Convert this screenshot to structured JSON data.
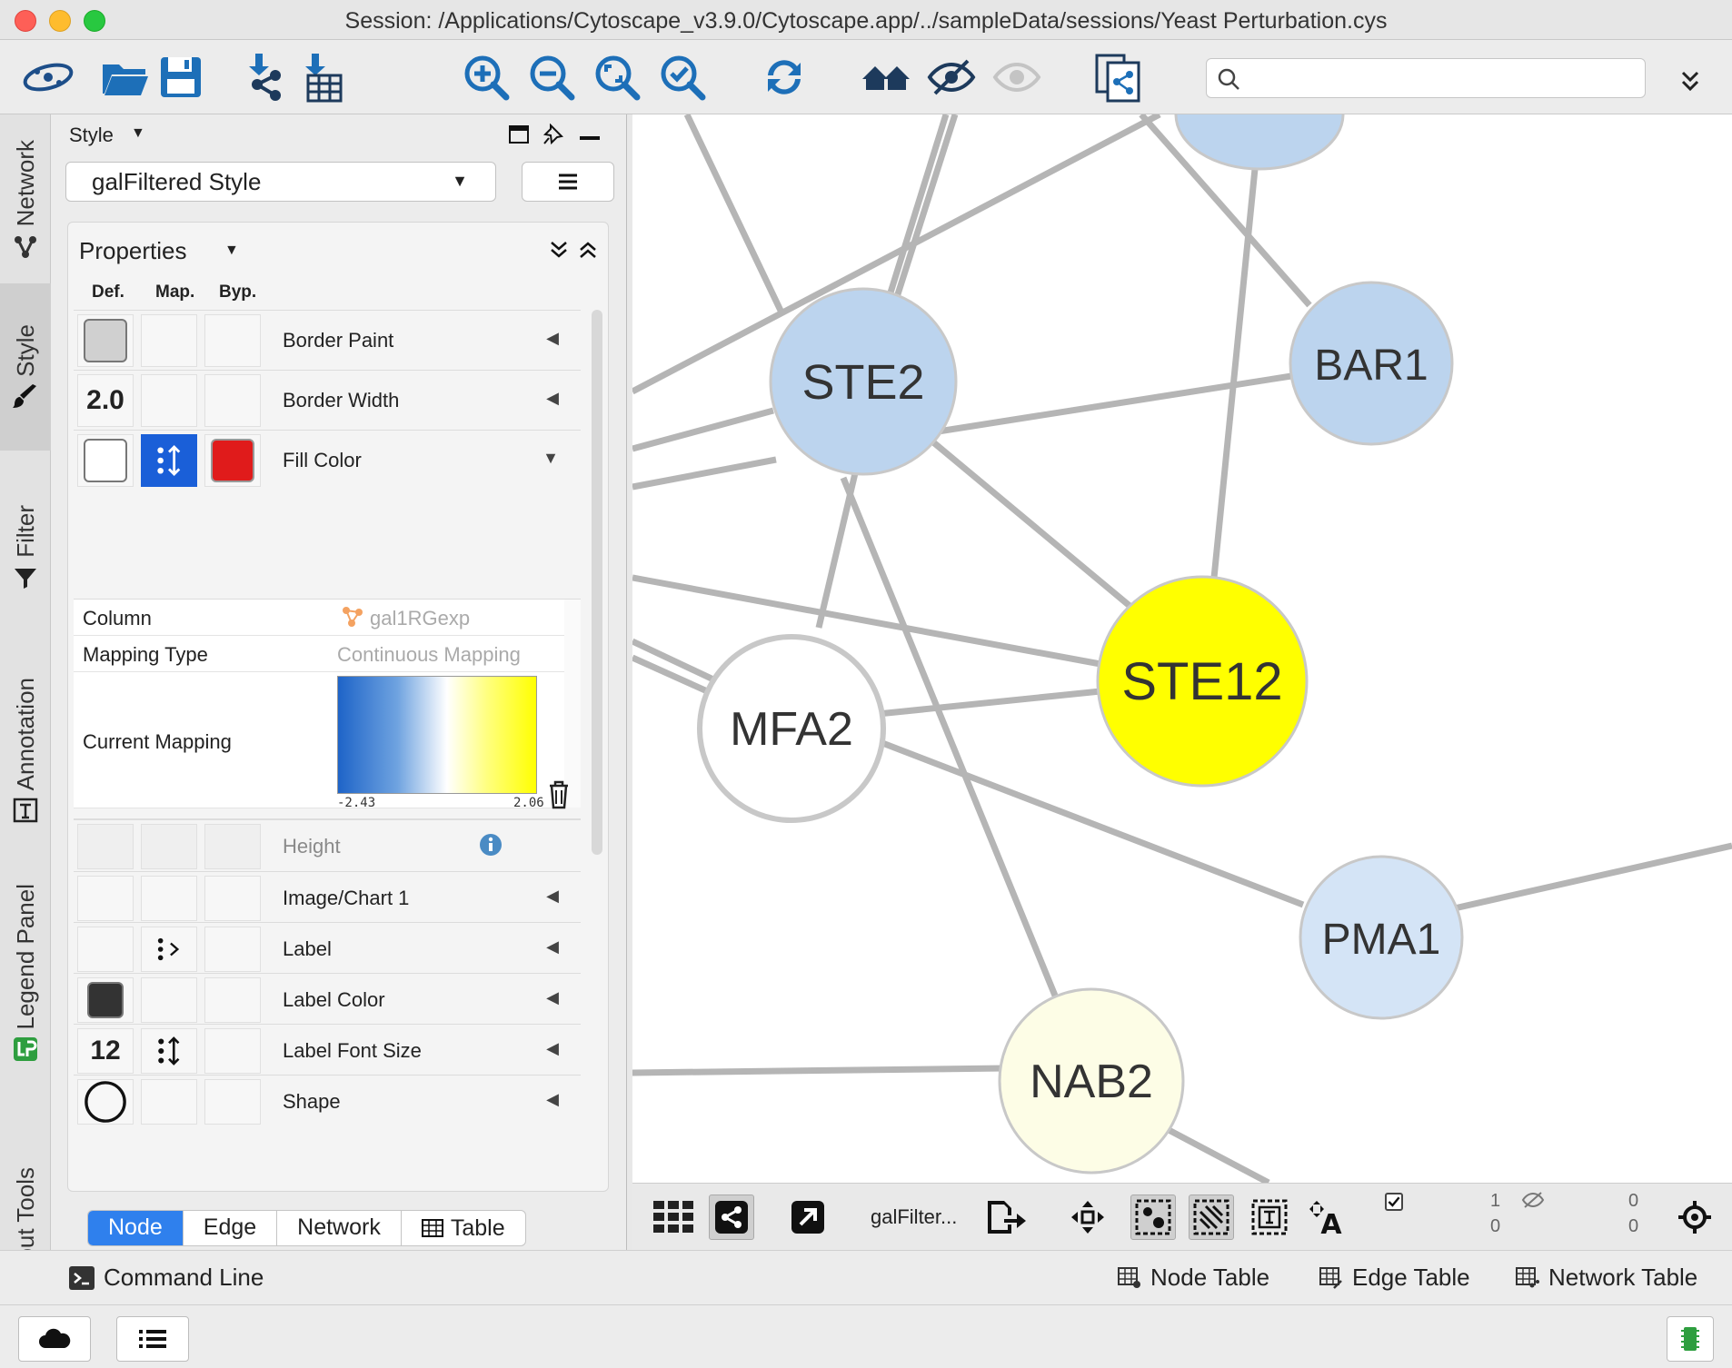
{
  "window": {
    "title": "Session: /Applications/Cytoscape_v3.9.0/Cytoscape.app/../sampleData/sessions/Yeast Perturbation.cys"
  },
  "toolbar": {
    "icons": [
      "cytoscape-logo-icon",
      "open-session-icon",
      "save-session-icon",
      "import-network-icon",
      "import-table-icon",
      "zoom-in-icon",
      "zoom-out-icon",
      "zoom-fit-icon",
      "zoom-selected-icon",
      "apply-layout-icon",
      "show-all-icon",
      "hide-selected-icon",
      "show-selected-icon",
      "create-network-icon"
    ],
    "search": {
      "placeholder": "",
      "value": ""
    }
  },
  "sidebar": {
    "tabs": [
      {
        "label": "Network",
        "icon": "network-icon",
        "active": false
      },
      {
        "label": "Style",
        "icon": "brush-icon",
        "active": true
      },
      {
        "label": "Filter",
        "icon": "filter-icon",
        "active": false
      },
      {
        "label": "Annotation",
        "icon": "annotation-icon",
        "active": false
      },
      {
        "label": "Legend Panel",
        "icon": "legend-panel-icon",
        "active": false
      },
      {
        "label": "Layout Tools",
        "icon": "layout-tools-icon",
        "active": false
      }
    ]
  },
  "style_panel": {
    "header": "Style",
    "selected_style": "galFiltered Style",
    "properties_title": "Properties",
    "columns": {
      "def": "Def.",
      "map": "Map.",
      "byp": "Byp."
    },
    "rows": [
      {
        "name": "Border Paint",
        "def": "",
        "def_color": "#d0d0d0"
      },
      {
        "name": "Border Width",
        "def": "2.0"
      },
      {
        "name": "Fill Color",
        "def_color": "#ffffff",
        "byp_color": "#e01b1b",
        "expanded": true
      },
      {
        "name": "Height",
        "disabled": true
      },
      {
        "name": "Image/Chart 1"
      },
      {
        "name": "Label"
      },
      {
        "name": "Label Color",
        "def_color": "#333333"
      },
      {
        "name": "Label Font Size",
        "def": "12"
      },
      {
        "name": "Shape"
      }
    ],
    "fill_mapping": {
      "column_label": "Column",
      "column_value": "gal1RGexp",
      "mapping_type_label": "Mapping Type",
      "mapping_type_value": "Continuous Mapping",
      "current_mapping_label": "Current Mapping",
      "min": "-2.43",
      "max": "2.06"
    },
    "bottom_tabs": [
      "Node",
      "Edge",
      "Network",
      "Table"
    ],
    "active_tab": "Node"
  },
  "network": {
    "nodes": [
      {
        "label": "STE2",
        "fill": "#bcd4ee"
      },
      {
        "label": "BAR1",
        "fill": "#bcd4ee"
      },
      {
        "label": "STE12",
        "fill": "#ffff00"
      },
      {
        "label": "MFA2",
        "fill": "#ffffff"
      },
      {
        "label": "PMA1",
        "fill": "#d4e4f6"
      },
      {
        "label": "NAB2",
        "fill": "#fdfde6"
      }
    ]
  },
  "network_bar": {
    "network_name": "galFilter...",
    "selected_nodes": "1",
    "selected_edges": "0",
    "hidden_nodes": "0",
    "hidden_edges": "0"
  },
  "footer": {
    "command_line": "Command Line",
    "node_table": "Node Table",
    "edge_table": "Edge Table",
    "network_table": "Network Table"
  }
}
